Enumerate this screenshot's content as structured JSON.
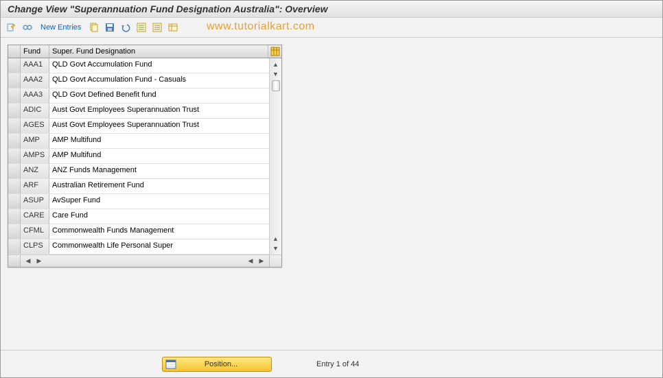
{
  "title": "Change View \"Superannuation Fund Designation Australia\": Overview",
  "toolbar": {
    "new_entries_label": "New Entries"
  },
  "watermark": "www.tutorialkart.com",
  "table": {
    "col_fund": "Fund",
    "col_designation": "Super. Fund Designation",
    "rows": [
      {
        "fund": "AAA1",
        "des": "QLD Govt Accumulation Fund"
      },
      {
        "fund": "AAA2",
        "des": "QLD Govt Accumulation Fund -  Casuals"
      },
      {
        "fund": "AAA3",
        "des": "QLD Govt Defined Benefit fund"
      },
      {
        "fund": "ADIC",
        "des": "Aust Govt Employees Superannuation Trust"
      },
      {
        "fund": "AGES",
        "des": "Aust Govt Employees Superannuation Trust"
      },
      {
        "fund": "AMP",
        "des": "AMP Multifund"
      },
      {
        "fund": "AMPS",
        "des": "AMP Multifund"
      },
      {
        "fund": "ANZ",
        "des": "ANZ Funds Management"
      },
      {
        "fund": "ARF",
        "des": "Australian Retirement Fund"
      },
      {
        "fund": "ASUP",
        "des": "AvSuper Fund"
      },
      {
        "fund": "CARE",
        "des": "Care  Fund"
      },
      {
        "fund": "CFML",
        "des": "Commonwealth Funds Management"
      },
      {
        "fund": "CLPS",
        "des": "Commonwealth Life Personal Super"
      }
    ]
  },
  "footer": {
    "position_label": "Position...",
    "entry_text": "Entry 1 of 44"
  }
}
